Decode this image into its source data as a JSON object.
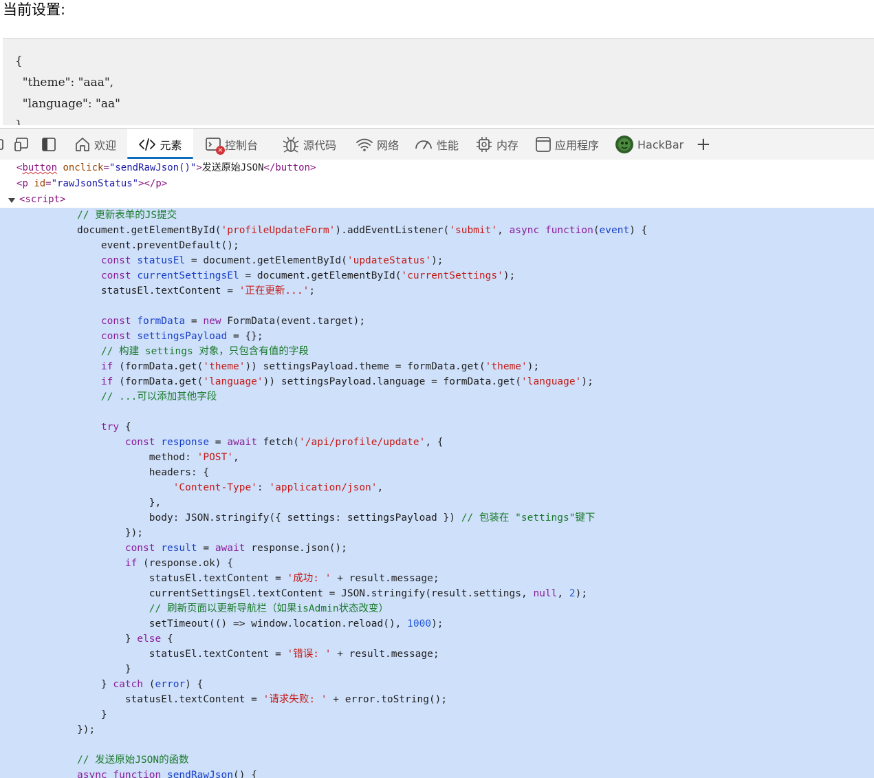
{
  "page": {
    "heading": "当前设置:",
    "settings_json": "{\n  \"theme\": \"aaa\",\n  \"language\": \"aa\"\n}"
  },
  "devtools": {
    "tabs": [
      {
        "label": "欢迎",
        "icon": "home-icon"
      },
      {
        "label": "元素",
        "icon": "code-brackets-icon",
        "active": true
      },
      {
        "label": "控制台",
        "icon": "console-icon",
        "error_badge": "×"
      },
      {
        "label": "源代码",
        "icon": "bug-icon"
      },
      {
        "label": "网络",
        "icon": "wifi-icon"
      },
      {
        "label": "性能",
        "icon": "gauge-icon"
      },
      {
        "label": "内存",
        "icon": "chip-icon"
      },
      {
        "label": "应用程序",
        "icon": "app-window-icon"
      },
      {
        "label": "HackBar",
        "icon": "hackbar-logo-icon"
      }
    ],
    "add_tab_label": "+",
    "accent_color": "#0f6cbd"
  },
  "dom": {
    "button": {
      "tag": "button",
      "attr": "onclick",
      "value": "sendRawJson()",
      "text": "发送原始JSON"
    },
    "p": {
      "tag": "p",
      "attr": "id",
      "value": "rawJsonStatus"
    },
    "script": {
      "tag": "script"
    }
  },
  "code": {
    "highlight_color": "#cfe0fa",
    "lines": [
      [
        [
          "c",
          "// 更新表单的JS提交"
        ]
      ],
      [
        [
          "p",
          "document.getElementById("
        ],
        [
          "s",
          "'profileUpdateForm'"
        ],
        [
          "p",
          ").addEventListener("
        ],
        [
          "s",
          "'submit'"
        ],
        [
          "p",
          ", "
        ],
        [
          "k",
          "async"
        ],
        [
          "p",
          " "
        ],
        [
          "k",
          "function"
        ],
        [
          "p",
          "("
        ],
        [
          "v",
          "event"
        ],
        [
          "p",
          ") {"
        ]
      ],
      [
        [
          "p",
          "    event.preventDefault();"
        ]
      ],
      [
        [
          "p",
          "    "
        ],
        [
          "k",
          "const"
        ],
        [
          "p",
          " "
        ],
        [
          "v",
          "statusEl"
        ],
        [
          "p",
          " = document.getElementById("
        ],
        [
          "s",
          "'updateStatus'"
        ],
        [
          "p",
          ");"
        ]
      ],
      [
        [
          "p",
          "    "
        ],
        [
          "k",
          "const"
        ],
        [
          "p",
          " "
        ],
        [
          "v",
          "currentSettingsEl"
        ],
        [
          "p",
          " = document.getElementById("
        ],
        [
          "s",
          "'currentSettings'"
        ],
        [
          "p",
          ");"
        ]
      ],
      [
        [
          "p",
          "    statusEl.textContent = "
        ],
        [
          "s",
          "'正在更新...'"
        ],
        [
          "p",
          ";"
        ]
      ],
      [],
      [
        [
          "p",
          "    "
        ],
        [
          "k",
          "const"
        ],
        [
          "p",
          " "
        ],
        [
          "v",
          "formData"
        ],
        [
          "p",
          " = "
        ],
        [
          "k",
          "new"
        ],
        [
          "p",
          " FormData(event.target);"
        ]
      ],
      [
        [
          "p",
          "    "
        ],
        [
          "k",
          "const"
        ],
        [
          "p",
          " "
        ],
        [
          "v",
          "settingsPayload"
        ],
        [
          "p",
          " = {};"
        ]
      ],
      [
        [
          "p",
          "    "
        ],
        [
          "c",
          "// 构建 settings 对象，只包含有值的字段"
        ]
      ],
      [
        [
          "p",
          "    "
        ],
        [
          "k",
          "if"
        ],
        [
          "p",
          " (formData.get("
        ],
        [
          "s",
          "'theme'"
        ],
        [
          "p",
          ")) settingsPayload.theme = formData.get("
        ],
        [
          "s",
          "'theme'"
        ],
        [
          "p",
          ");"
        ]
      ],
      [
        [
          "p",
          "    "
        ],
        [
          "k",
          "if"
        ],
        [
          "p",
          " (formData.get("
        ],
        [
          "s",
          "'language'"
        ],
        [
          "p",
          ")) settingsPayload.language = formData.get("
        ],
        [
          "s",
          "'language'"
        ],
        [
          "p",
          ");"
        ]
      ],
      [
        [
          "p",
          "    "
        ],
        [
          "c",
          "// ...可以添加其他字段"
        ]
      ],
      [],
      [
        [
          "p",
          "    "
        ],
        [
          "k",
          "try"
        ],
        [
          "p",
          " {"
        ]
      ],
      [
        [
          "p",
          "        "
        ],
        [
          "k",
          "const"
        ],
        [
          "p",
          " "
        ],
        [
          "v",
          "response"
        ],
        [
          "p",
          " = "
        ],
        [
          "k",
          "await"
        ],
        [
          "p",
          " fetch("
        ],
        [
          "s",
          "'/api/profile/update'"
        ],
        [
          "p",
          ", {"
        ]
      ],
      [
        [
          "p",
          "            method: "
        ],
        [
          "s",
          "'POST'"
        ],
        [
          "p",
          ","
        ]
      ],
      [
        [
          "p",
          "            headers: {"
        ]
      ],
      [
        [
          "p",
          "                "
        ],
        [
          "s",
          "'Content-Type'"
        ],
        [
          "p",
          ": "
        ],
        [
          "s",
          "'application/json'"
        ],
        [
          "p",
          ","
        ]
      ],
      [
        [
          "p",
          "            },"
        ]
      ],
      [
        [
          "p",
          "            body: JSON.stringify({ settings: settingsPayload }) "
        ],
        [
          "c",
          "// 包装在 \"settings\"键下"
        ]
      ],
      [
        [
          "p",
          "        });"
        ]
      ],
      [
        [
          "p",
          "        "
        ],
        [
          "k",
          "const"
        ],
        [
          "p",
          " "
        ],
        [
          "v",
          "result"
        ],
        [
          "p",
          " = "
        ],
        [
          "k",
          "await"
        ],
        [
          "p",
          " response.json();"
        ]
      ],
      [
        [
          "p",
          "        "
        ],
        [
          "k",
          "if"
        ],
        [
          "p",
          " (response.ok) {"
        ]
      ],
      [
        [
          "p",
          "            statusEl.textContent = "
        ],
        [
          "s",
          "'成功: '"
        ],
        [
          "p",
          " + result.message;"
        ]
      ],
      [
        [
          "p",
          "            currentSettingsEl.textContent = JSON.stringify(result.settings, "
        ],
        [
          "k",
          "null"
        ],
        [
          "p",
          ", "
        ],
        [
          "n",
          "2"
        ],
        [
          "p",
          ");"
        ]
      ],
      [
        [
          "p",
          "            "
        ],
        [
          "c",
          "// 刷新页面以更新导航栏（如果isAdmin状态改变）"
        ]
      ],
      [
        [
          "p",
          "            setTimeout(() => window.location.reload(), "
        ],
        [
          "n",
          "1000"
        ],
        [
          "p",
          ");"
        ]
      ],
      [
        [
          "p",
          "        } "
        ],
        [
          "k",
          "else"
        ],
        [
          "p",
          " {"
        ]
      ],
      [
        [
          "p",
          "            statusEl.textContent = "
        ],
        [
          "s",
          "'错误: '"
        ],
        [
          "p",
          " + result.message;"
        ]
      ],
      [
        [
          "p",
          "        }"
        ]
      ],
      [
        [
          "p",
          "    } "
        ],
        [
          "k",
          "catch"
        ],
        [
          "p",
          " ("
        ],
        [
          "v",
          "error"
        ],
        [
          "p",
          ") {"
        ]
      ],
      [
        [
          "p",
          "        statusEl.textContent = "
        ],
        [
          "s",
          "'请求失败: '"
        ],
        [
          "p",
          " + error.toString();"
        ]
      ],
      [
        [
          "p",
          "    }"
        ]
      ],
      [
        [
          "p",
          "});"
        ]
      ],
      [],
      [
        [
          "c",
          "// 发送原始JSON的函数"
        ]
      ],
      [
        [
          "k",
          "async"
        ],
        [
          "p",
          " "
        ],
        [
          "k",
          "function"
        ],
        [
          "p",
          " "
        ],
        [
          "v",
          "sendRawJson"
        ],
        [
          "p",
          "() {"
        ]
      ]
    ]
  }
}
